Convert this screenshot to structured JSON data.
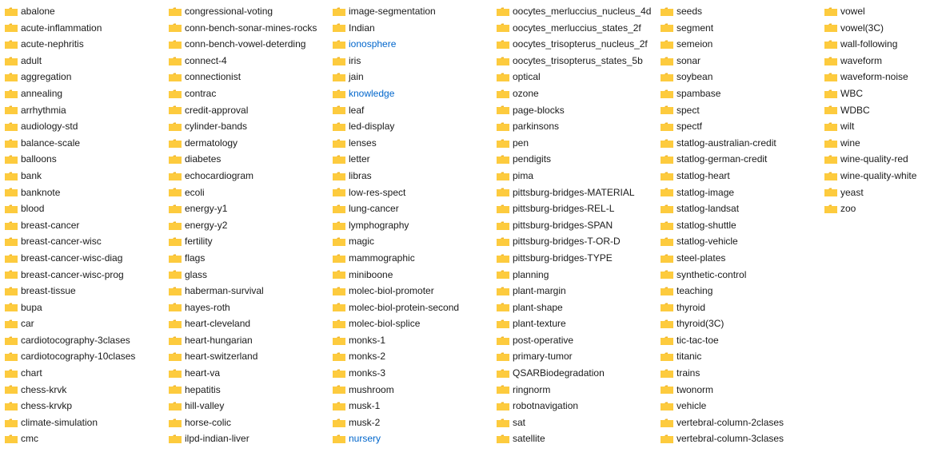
{
  "columns": [
    {
      "id": "col1",
      "items": [
        "abalone",
        "acute-inflammation",
        "acute-nephritis",
        "adult",
        "aggregation",
        "annealing",
        "arrhythmia",
        "audiology-std",
        "balance-scale",
        "balloons",
        "bank",
        "banknote",
        "blood",
        "breast-cancer",
        "breast-cancer-wisc",
        "breast-cancer-wisc-diag",
        "breast-cancer-wisc-prog",
        "breast-tissue",
        "bupa",
        "car",
        "cardiotocography-3clases",
        "cardiotocography-10clases",
        "chart",
        "chess-krvk",
        "chess-krvkp",
        "climate-simulation",
        "cmc"
      ]
    },
    {
      "id": "col2",
      "items": [
        "congressional-voting",
        "conn-bench-sonar-mines-rocks",
        "conn-bench-vowel-deterding",
        "connect-4",
        "connectionist",
        "contrac",
        "credit-approval",
        "cylinder-bands",
        "dermatology",
        "diabetes",
        "echocardiogram",
        "ecoli",
        "energy-y1",
        "energy-y2",
        "fertility",
        "flags",
        "glass",
        "haberman-survival",
        "hayes-roth",
        "heart-cleveland",
        "heart-hungarian",
        "heart-switzerland",
        "heart-va",
        "hepatitis",
        "hill-valley",
        "horse-colic",
        "ilpd-indian-liver"
      ]
    },
    {
      "id": "col3",
      "items": [
        "image-segmentation",
        "Indian",
        "ionosphere",
        "iris",
        "jain",
        "knowledge",
        "leaf",
        "led-display",
        "lenses",
        "letter",
        "libras",
        "low-res-spect",
        "lung-cancer",
        "lymphography",
        "magic",
        "mammographic",
        "miniboone",
        "molec-biol-promoter",
        "molec-biol-protein-second",
        "molec-biol-splice",
        "monks-1",
        "monks-2",
        "monks-3",
        "mushroom",
        "musk-1",
        "musk-2",
        "nursery"
      ]
    },
    {
      "id": "col4",
      "items": [
        "oocytes_merluccius_nucleus_4d",
        "oocytes_merluccius_states_2f",
        "oocytes_trisopterus_nucleus_2f",
        "oocytes_trisopterus_states_5b",
        "optical",
        "ozone",
        "page-blocks",
        "parkinsons",
        "pen",
        "pendigits",
        "pima",
        "pittsburg-bridges-MATERIAL",
        "pittsburg-bridges-REL-L",
        "pittsburg-bridges-SPAN",
        "pittsburg-bridges-T-OR-D",
        "pittsburg-bridges-TYPE",
        "planning",
        "plant-margin",
        "plant-shape",
        "plant-texture",
        "post-operative",
        "primary-tumor",
        "QSARBiodegradation",
        "ringnorm",
        "robotnavigation",
        "sat",
        "satellite"
      ]
    },
    {
      "id": "col5",
      "items": [
        "seeds",
        "segment",
        "semeion",
        "sonar",
        "soybean",
        "spambase",
        "spect",
        "spectf",
        "statlog-australian-credit",
        "statlog-german-credit",
        "statlog-heart",
        "statlog-image",
        "statlog-landsat",
        "statlog-shuttle",
        "statlog-vehicle",
        "steel-plates",
        "synthetic-control",
        "teaching",
        "thyroid",
        "thyroid(3C)",
        "tic-tac-toe",
        "titanic",
        "trains",
        "twonorm",
        "vehicle",
        "vertebral-column-2clases",
        "vertebral-column-3clases"
      ]
    },
    {
      "id": "col6",
      "items": [
        "vowel",
        "vowel(3C)",
        "wall-following",
        "waveform",
        "waveform-noise",
        "WBC",
        "WDBC",
        "wilt",
        "wine",
        "wine-quality-red",
        "wine-quality-white",
        "yeast",
        "zoo"
      ]
    }
  ],
  "accent_color": "#0066cc",
  "folder_color_body": "#FDCB3E",
  "folder_color_tab": "#F0B429"
}
